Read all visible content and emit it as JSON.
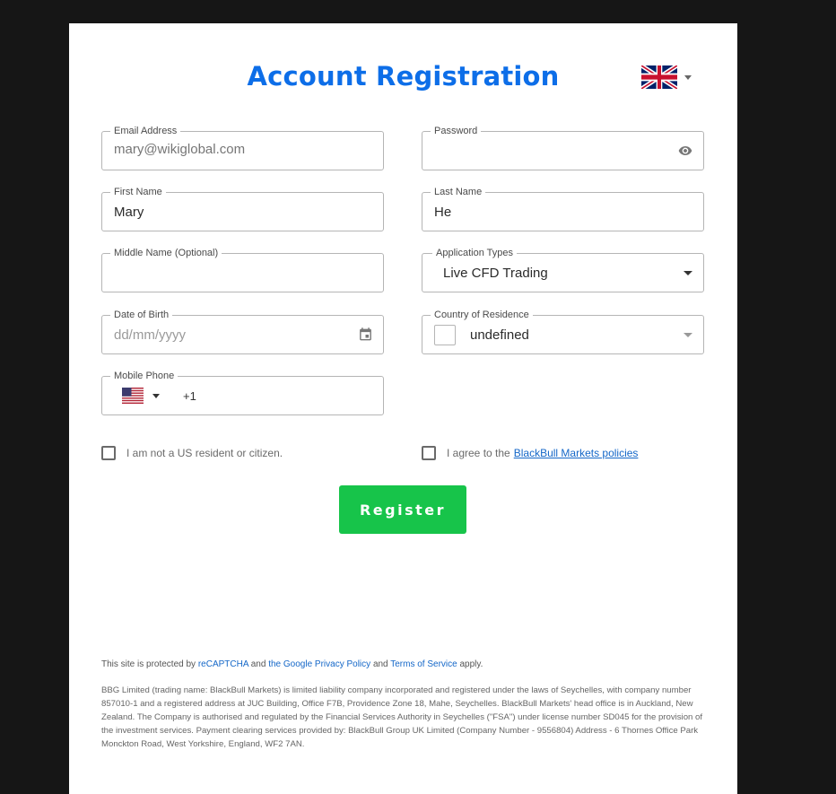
{
  "header": {
    "title": "Account Registration",
    "language_icon": "uk-flag-icon"
  },
  "fields": {
    "email": {
      "label": "Email Address",
      "placeholder": "mary@wikiglobal.com",
      "value": ""
    },
    "password": {
      "label": "Password",
      "value": "",
      "icon": "eye-icon"
    },
    "first_name": {
      "label": "First Name",
      "value": "Mary"
    },
    "last_name": {
      "label": "Last Name",
      "value": "He"
    },
    "middle_name": {
      "label": "Middle Name (Optional)",
      "value": ""
    },
    "application_type": {
      "label": "Application Types",
      "value": "Live CFD Trading"
    },
    "dob": {
      "label": "Date of Birth",
      "placeholder": "dd/mm/yyyy",
      "icon": "calendar-icon"
    },
    "country": {
      "label": "Country of Residence",
      "value": "undefined"
    },
    "mobile": {
      "label": "Mobile Phone",
      "country_icon": "us-flag-icon",
      "dial_code": "+1"
    }
  },
  "checkboxes": {
    "us_resident": {
      "label": "I am not a US resident or citizen.",
      "checked": false
    },
    "policies": {
      "label": "I agree to the",
      "link": "BlackBull Markets policies",
      "checked": false
    }
  },
  "register_button": "Register",
  "footer": {
    "recaptcha": {
      "prefix": "This site is protected by",
      "link1": "reCAPTCHA",
      "and1": "and",
      "link2": "the Google Privacy Policy",
      "and2": "and",
      "link3": "Terms of Service",
      "suffix": "apply."
    },
    "legal": "BBG Limited (trading name: BlackBull Markets) is limited liability company incorporated and registered under the laws of Seychelles, with company number 857010-1 and a registered address at JUC Building, Office F7B, Providence Zone 18, Mahe, Seychelles. BlackBull Markets' head office is in Auckland, New Zealand. The Company is authorised and regulated by the Financial Services Authority in Seychelles (\"FSA\") under license number SD045 for the provision of the investment services. Payment clearing services provided by: BlackBull Group UK Limited (Company Number - 9556804) Address - 6 Thornes Office Park Monckton Road, West Yorkshire, England, WF2 7AN."
  },
  "colors": {
    "page_bg": "#161616",
    "title": "#0d6ee8",
    "register_bg": "#17c44a",
    "link": "#1467c8"
  }
}
